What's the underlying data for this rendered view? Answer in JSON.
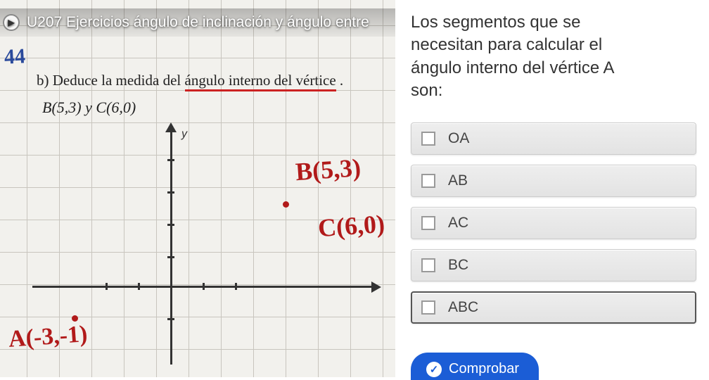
{
  "video": {
    "title": "U207 Ejercicios ángulo de inclinación y ángulo entre"
  },
  "exercise": {
    "number": "44",
    "problem_label": "b) Deduce la medida del ",
    "problem_underlined": "ángulo interno del vértice",
    "coords_line": "B(5,3) y C(6,0)",
    "y_axis_label": "y"
  },
  "annotations": {
    "pointA": "A(-3,-1)",
    "pointB": "B(5,3)",
    "pointC": "C(6,0)"
  },
  "question": {
    "text_line1": "Los segmentos que se",
    "text_line2": "necesitan para calcular el",
    "text_line3": "ángulo interno del vértice A",
    "text_line4": "son:"
  },
  "options": [
    {
      "label": "OA"
    },
    {
      "label": "AB"
    },
    {
      "label": "AC"
    },
    {
      "label": "BC"
    },
    {
      "label": "ABC"
    }
  ],
  "buttons": {
    "check": "Comprobar"
  }
}
